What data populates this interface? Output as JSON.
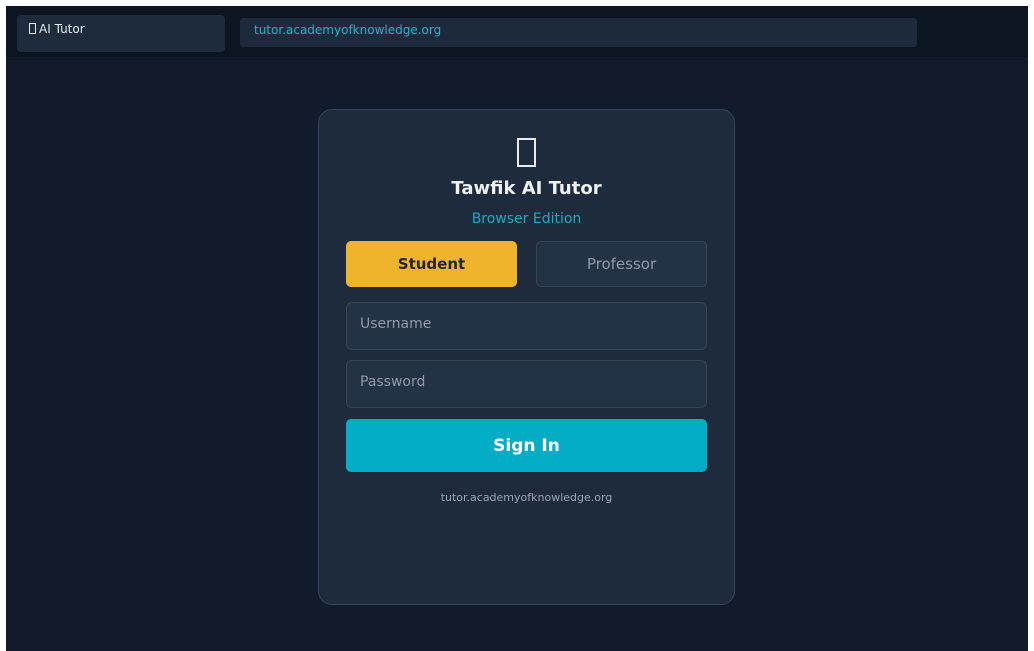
{
  "browser": {
    "tab_title": "AI Tutor",
    "tab_icon": "app-icon",
    "url": "tutor.academyofknowledge.org"
  },
  "login": {
    "logo_icon": "app-logo-icon",
    "title": "Tawfik AI Tutor",
    "subtitle": "Browser Edition",
    "roles": [
      {
        "label": "Student",
        "selected": true
      },
      {
        "label": "Professor",
        "selected": false
      }
    ],
    "username": {
      "value": "",
      "placeholder": "Username"
    },
    "password": {
      "value": "",
      "placeholder": "Password"
    },
    "submit_label": "Sign In",
    "footer": "tutor.academyofknowledge.org"
  },
  "colors": {
    "background": "#111b29",
    "card": "#1e2b3c",
    "accent_selected": "#efb42b",
    "primary_button": "#04adc6",
    "link": "#12aec6"
  }
}
